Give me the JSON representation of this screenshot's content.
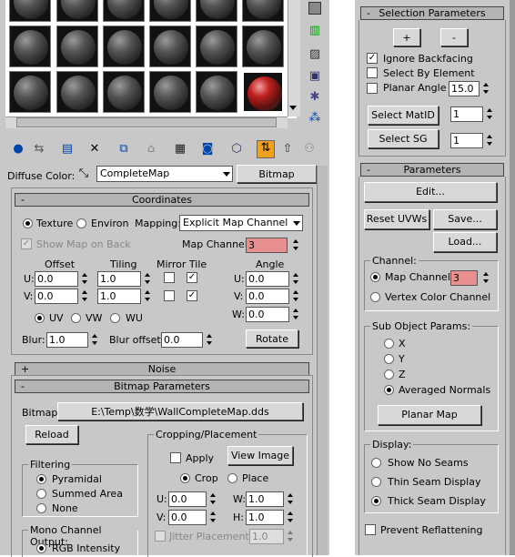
{
  "left": {
    "diffuse_label": "Diffuse Color:",
    "map_name": "CompleteMap",
    "map_type_button": "Bitmap",
    "coordinates": {
      "title": "Coordinates",
      "texture": "Texture",
      "environ": "Environ",
      "mapping_label": "Mapping:",
      "mapping_value": "Explicit Map Channel",
      "show_map_on_back": "Show Map on Back",
      "map_channel_label": "Map Channel:",
      "map_channel_value": "3",
      "offset": "Offset",
      "tiling": "Tiling",
      "mirror_tile": "Mirror Tile",
      "angle": "Angle",
      "u": "U:",
      "v": "V:",
      "w": "W:",
      "u_offset": "0.0",
      "v_offset": "0.0",
      "u_tiling": "1.0",
      "v_tiling": "1.0",
      "u_angle": "0.0",
      "v_angle": "0.0",
      "w_angle": "0.0",
      "uv": "UV",
      "vw": "VW",
      "wu": "WU",
      "blur_label": "Blur:",
      "blur_value": "1.0",
      "blur_offset_label": "Blur offset:",
      "blur_offset_value": "0.0",
      "rotate": "Rotate"
    },
    "noise_title": "Noise",
    "bitmap_params": {
      "title": "Bitmap Parameters",
      "bitmap_label": "Bitmap:",
      "bitmap_path": "E:\\Temp\\数学\\WallCompleteMap.dds",
      "reload": "Reload",
      "cropping": "Cropping/Placement",
      "apply": "Apply",
      "view_image": "View Image",
      "crop": "Crop",
      "place": "Place",
      "u_crop": "0.0",
      "v_crop": "0.0",
      "w_crop": "1.0",
      "h_crop": "1.0",
      "h": "H:",
      "jitter": "Jitter Placement:",
      "jitter_value": "1.0",
      "filtering": "Filtering",
      "pyramidal": "Pyramidal",
      "summed_area": "Summed Area",
      "none": "None",
      "mono_output": "Mono Channel Output:",
      "rgb_intensity": "RGB Intensity"
    }
  },
  "right": {
    "selection_params": "Selection Parameters",
    "plus": "+",
    "minus": "-",
    "ignore_backfacing": "Ignore Backfacing",
    "select_by_element": "Select By Element",
    "planar_angle": "Planar Angle",
    "planar_angle_value": "15.0",
    "select_matid": "Select MatID",
    "matid_value": "1",
    "select_sg": "Select SG",
    "sg_value": "1",
    "parameters": "Parameters",
    "edit": "Edit...",
    "reset_uvws": "Reset UVWs",
    "save": "Save...",
    "load": "Load...",
    "channel": "Channel:",
    "map_channel": "Map Channel:",
    "map_channel_value": "3",
    "vertex_color_channel": "Vertex Color Channel",
    "sub_object_params": "Sub Object Params:",
    "x": "X",
    "y": "Y",
    "z": "Z",
    "averaged_normals": "Averaged Normals",
    "planar_map": "Planar Map",
    "display": "Display:",
    "show_no_seams": "Show No Seams",
    "thin_seam_display": "Thin Seam Display",
    "thick_seam_display": "Thick Seam Display",
    "prevent_reflattening": "Prevent Reflattening"
  }
}
